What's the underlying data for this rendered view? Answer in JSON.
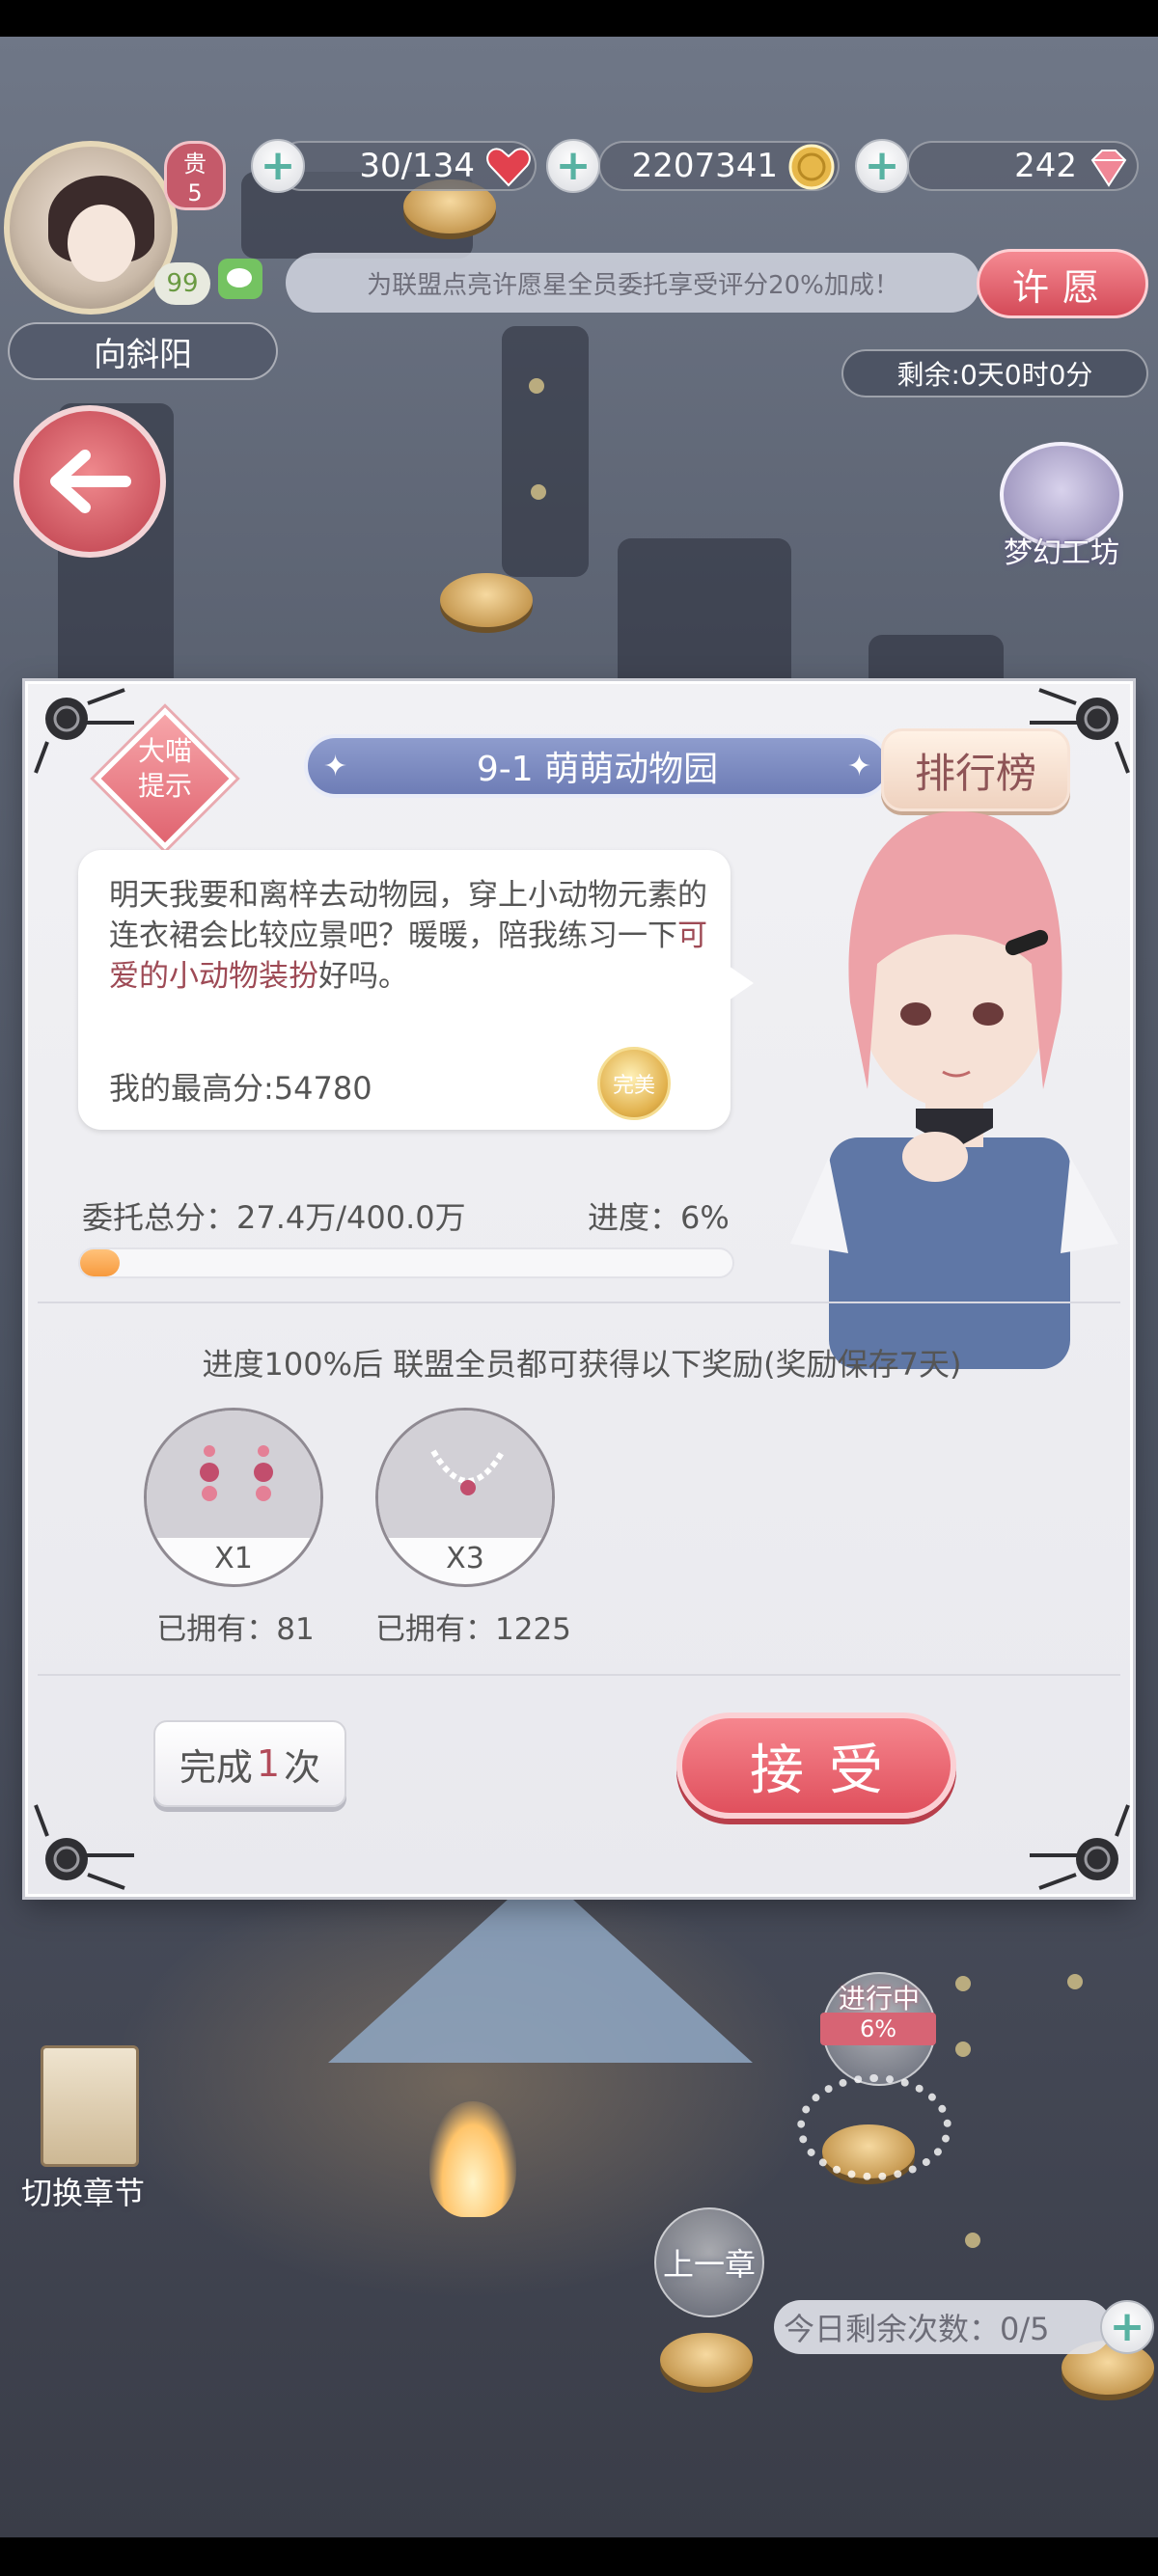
{
  "hud": {
    "stamina": "30/134",
    "gold": "2207341",
    "diamonds": "242",
    "vip_label": "贵",
    "vip_level": "5",
    "player_level": "99",
    "player_name": "向斜阳",
    "announcement": "为联盟点亮许愿星全员委托享受评分20%加成！",
    "wish_button": "许愿",
    "remaining_time": "剩余:0天0时0分",
    "dream_workshop": "梦幻工坊"
  },
  "dialog": {
    "hint_line1": "大喵",
    "hint_line2": "提示",
    "stage_title": "9-1 萌萌动物园",
    "ranking_button": "排行榜",
    "speech_part1": "明天我要和离梓去动物园，穿上小动物元素的连衣裙会比较应景吧？暖暖，陪我练习一下",
    "speech_highlight": "可爱的小动物装扮",
    "speech_part2": "好吗。",
    "best_score": "我的最高分:54780",
    "perfect_medal": "完美",
    "total_score": "委托总分：27.4万/400.0万",
    "progress_text": "进度：6%",
    "progress": 0.06,
    "reward_note": "进度100%后 联盟全员都可获得以下奖励(奖励保存7天)",
    "rewards": [
      {
        "icon": "earrings-icon",
        "quantity": "X1",
        "owned": "已拥有：81"
      },
      {
        "icon": "necklace-icon",
        "quantity": "X3",
        "owned": "已拥有：1225"
      }
    ],
    "complete_prefix": "完成",
    "complete_count": "1",
    "complete_suffix": "次",
    "accept_button": "接受"
  },
  "scene": {
    "switch_chapter": "切换章节",
    "in_progress_label": "进行中",
    "in_progress_pct": "6%",
    "prev_chapter": "上一章",
    "remaining_today": "今日剩余次数：0/5"
  },
  "colors": {
    "accent_red": "#e0505d",
    "stage_blue": "#7f8dc3",
    "progress_orange": "#f79a3e",
    "highlight_text": "#9e4a55"
  }
}
